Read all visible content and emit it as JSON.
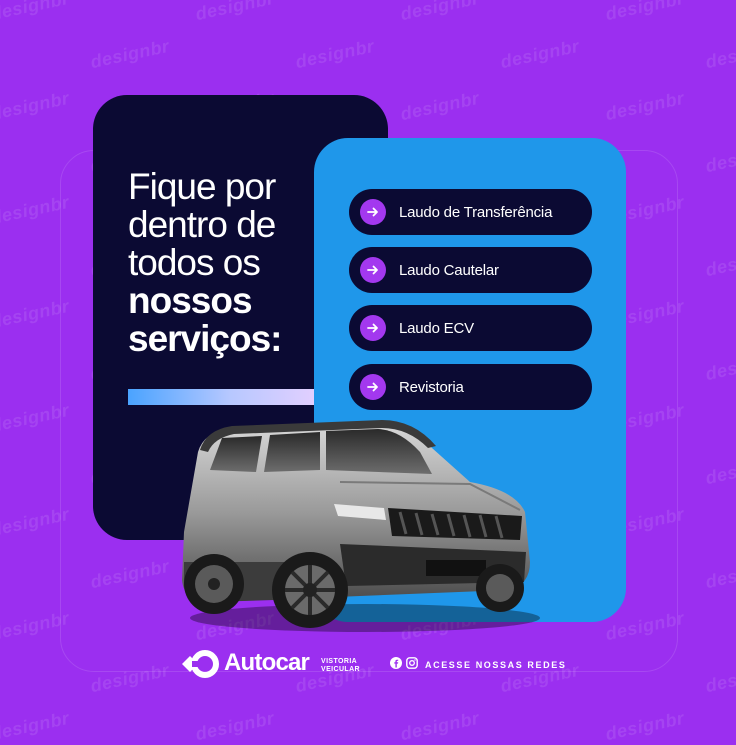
{
  "colors": {
    "background": "#9b2ff0",
    "dark_card": "#0b0a33",
    "blue_card": "#1f97ea",
    "accent_purple": "#a338ef"
  },
  "watermark": "design",
  "watermark_suffix": "br",
  "headline": {
    "line1": "Fique por",
    "line2": "dentro de",
    "line3": "todos os",
    "line4": "nossos",
    "line5": "serviços:"
  },
  "services": [
    {
      "icon": "arrow-right-icon",
      "label": "Laudo de Transferência"
    },
    {
      "icon": "arrow-right-icon",
      "label": "Laudo Cautelar"
    },
    {
      "icon": "arrow-right-icon",
      "label": "Laudo ECV"
    },
    {
      "icon": "arrow-right-icon",
      "label": "Revistoria"
    }
  ],
  "brand": {
    "name": "Autocar",
    "tagline_line1": "VISTORIA",
    "tagline_line2": "VEICULAR",
    "icon": "autocar-logo-icon"
  },
  "social": {
    "cta": "ACESSE NOSSAS REDES",
    "icons": [
      "facebook-icon",
      "instagram-icon"
    ]
  }
}
